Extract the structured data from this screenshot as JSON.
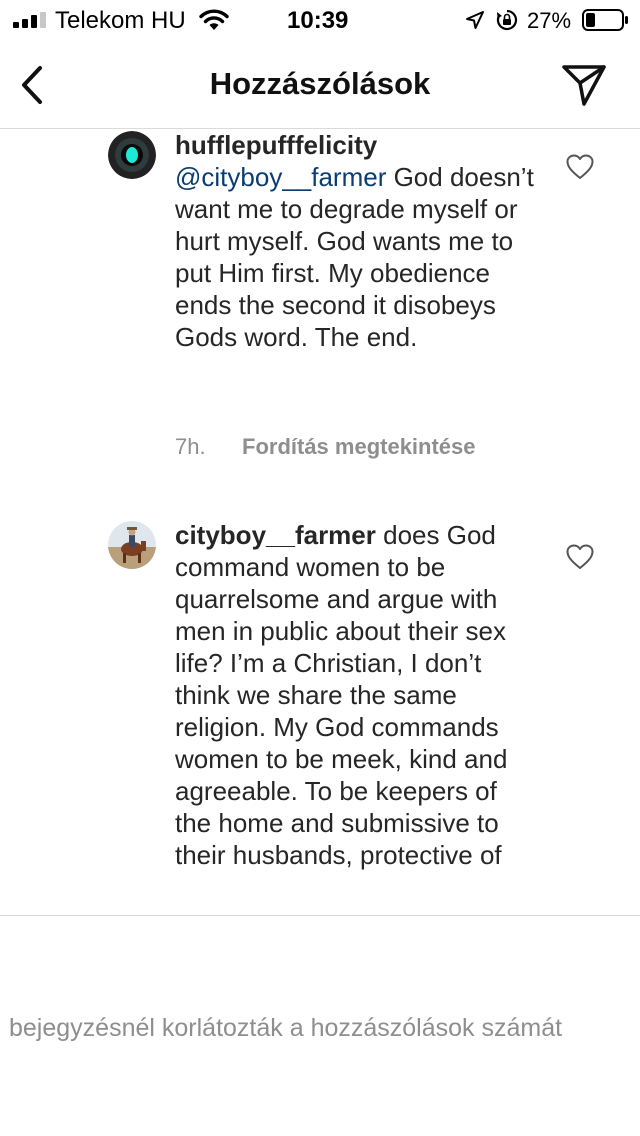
{
  "status_bar": {
    "carrier": "Telekom HU",
    "time": "10:39",
    "battery": "27%",
    "battery_level": 0.27
  },
  "header": {
    "title": "Hozzászólások",
    "back_icon": "chevron-left-icon",
    "share_icon": "paper-plane-icon"
  },
  "comments": [
    {
      "username": "hufflepufffelicity",
      "mention": "@cityboy__farmer",
      "text": " God doesn’t want me to degrade myself or hurt myself. God wants me to put Him first. My obedience ends the second it disobeys Gods word. The end.",
      "time": "7h.",
      "translate_label": "Fordítás megtekintése"
    },
    {
      "username": "cityboy__farmer",
      "text": " does God command women to be quarrelsome and argue with men in public about their sex life? I’m a Christian, I don’t think we share the same religion. My God commands women to be meek, kind and agreeable. To be keepers of the home and submissive to their husbands, protective of"
    }
  ],
  "footer": {
    "restricted_notice": "bejegyzésnél korlátozták a hozzászólások számát"
  },
  "colors": {
    "text": "#262626",
    "secondary": "#8e8e8e",
    "mention": "#0a3d73",
    "divider": "#dbdbdb",
    "avatar_ring": "#1de9d6"
  }
}
